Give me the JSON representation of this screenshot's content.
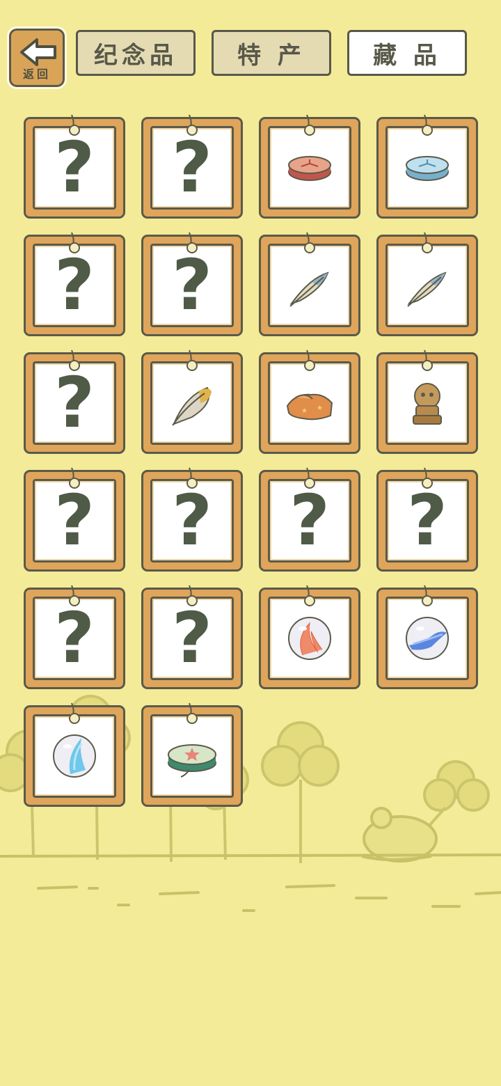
{
  "header": {
    "back_label": "返回",
    "tabs": [
      {
        "label": "纪念品",
        "active": false
      },
      {
        "label": "特 产",
        "active": false
      },
      {
        "label": "藏 品",
        "active": true
      }
    ]
  },
  "colors": {
    "background": "#f3eb97",
    "card_frame": "#dfa55b",
    "outline": "#5a5a4a"
  },
  "collection": {
    "items": [
      {
        "status": "unknown",
        "text": "?"
      },
      {
        "status": "unknown",
        "text": "?"
      },
      {
        "status": "collected",
        "icon": "red-coin-icon"
      },
      {
        "status": "collected",
        "icon": "blue-coin-icon"
      },
      {
        "status": "unknown",
        "text": "?"
      },
      {
        "status": "unknown",
        "text": "?"
      },
      {
        "status": "collected",
        "icon": "blue-feather-icon"
      },
      {
        "status": "collected",
        "icon": "blue-feather-icon"
      },
      {
        "status": "unknown",
        "text": "?"
      },
      {
        "status": "collected",
        "icon": "golden-feather-icon"
      },
      {
        "status": "collected",
        "icon": "star-cloth-icon"
      },
      {
        "status": "collected",
        "icon": "stone-statue-icon"
      },
      {
        "status": "unknown",
        "text": "?"
      },
      {
        "status": "unknown",
        "text": "?"
      },
      {
        "status": "unknown",
        "text": "?"
      },
      {
        "status": "unknown",
        "text": "?"
      },
      {
        "status": "unknown",
        "text": "?"
      },
      {
        "status": "unknown",
        "text": "?"
      },
      {
        "status": "collected",
        "icon": "red-marble-icon"
      },
      {
        "status": "collected",
        "icon": "blue-marble-icon"
      },
      {
        "status": "collected",
        "icon": "cyan-marble-icon"
      },
      {
        "status": "collected",
        "icon": "star-drum-icon"
      }
    ]
  }
}
